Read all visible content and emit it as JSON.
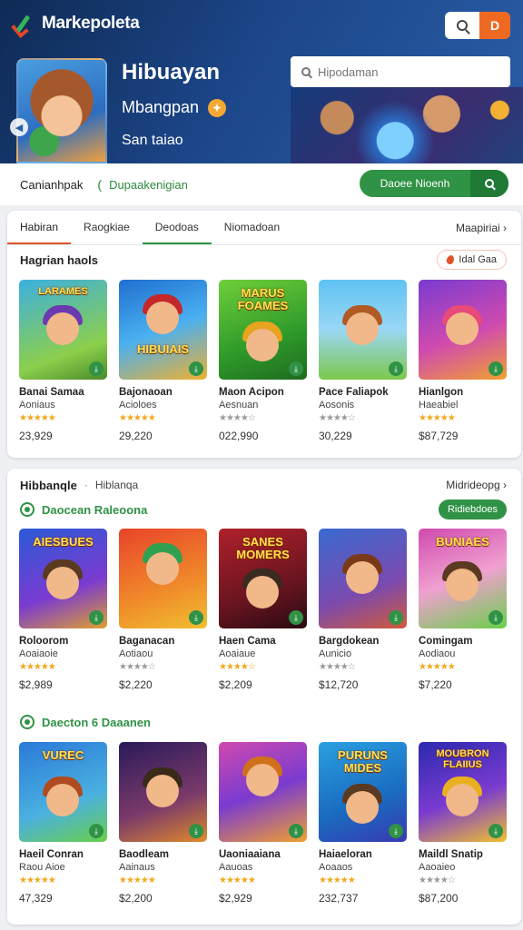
{
  "app": {
    "name": "Markepoleta",
    "user_initial": "D"
  },
  "hero": {
    "title": "Hibuayan",
    "subtitle": "Mbangpan",
    "meta": "San taiao",
    "search_placeholder": "Hipodaman"
  },
  "filter": {
    "label": "Canianhpak",
    "link": "Dupaakenigian",
    "cta": "Daoee Nioenh"
  },
  "tabs": {
    "items": [
      "Habiran",
      "Raogkiae",
      "Deodoas",
      "Niomadoan"
    ],
    "more": "Maapiriai"
  },
  "section1": {
    "title": "Hagrian haols",
    "pill": "Idal Gaa",
    "games": [
      {
        "thumb_title": "LARAMES",
        "name": "Banai Samaa",
        "sub": "Aoniaus",
        "stars": "★★★★★",
        "price": "23,929"
      },
      {
        "thumb_title": "HIBUIAIS",
        "name": "Bajonaoan",
        "sub": "Acioloes",
        "stars": "★★★★★",
        "price": "29,220"
      },
      {
        "thumb_title": "MARUS FOAMES",
        "name": "Maon Acipon",
        "sub": "Aesnuan",
        "stars": "★★★★☆",
        "price": "022,990"
      },
      {
        "thumb_title": "",
        "name": "Pace Faliapok",
        "sub": "Aosonis",
        "stars": "★★★★☆",
        "price": "30,229"
      },
      {
        "thumb_title": "",
        "name": "Hianlgon",
        "sub": "Haeabiel",
        "stars": "★★★★★",
        "price": "$87,729"
      }
    ]
  },
  "category": {
    "title": "Hibbanqle",
    "sub": "Hiblanqa",
    "more": "Midrideopg"
  },
  "section2": {
    "title": "Daocean Raleoona",
    "pill": "Ridiebdoes",
    "games": [
      {
        "thumb_title": "AIESBUES",
        "name": "Roloorom",
        "sub": "Aoaiaoie",
        "stars": "★★★★★",
        "price": "$2,989"
      },
      {
        "thumb_title": "",
        "name": "Baganacan",
        "sub": "Aotiaou",
        "stars": "★★★★☆",
        "price": "$2,220"
      },
      {
        "thumb_title": "SANES MOMERS",
        "name": "Haen Cama",
        "sub": "Aoaiaue",
        "stars": "★★★★☆",
        "price": "$2,209"
      },
      {
        "thumb_title": "",
        "name": "Bargdokean",
        "sub": "Aunicio",
        "stars": "★★★★☆",
        "price": "$12,720"
      },
      {
        "thumb_title": "BUNIAES",
        "name": "Comingam",
        "sub": "Aodiaou",
        "stars": "★★★★★",
        "price": "$7,220"
      }
    ]
  },
  "section3": {
    "title": "Daecton 6 Daaanen",
    "games": [
      {
        "thumb_title": "VUREC",
        "name": "Haeil Conran",
        "sub": "Raou Aioe",
        "stars": "★★★★★",
        "price": "47,329"
      },
      {
        "thumb_title": "",
        "name": "Baodleam",
        "sub": "Aainaus",
        "stars": "★★★★★",
        "price": "$2,200"
      },
      {
        "thumb_title": "",
        "name": "Uaoniaaiana",
        "sub": "Aauoas",
        "stars": "★★★★★",
        "price": "$2,929"
      },
      {
        "thumb_title": "PURUNS MIDES",
        "name": "Haiaeloran",
        "sub": "Aoaaos",
        "stars": "★★★★★",
        "price": "232,737"
      },
      {
        "thumb_title": "MOUBRON FLAIIUS",
        "name": "Maildl Snatip",
        "sub": "Aaoaieo",
        "stars": "★★★★☆",
        "price": "$87,200"
      }
    ]
  },
  "colors": {
    "brand_dark": "#1c4688",
    "accent": "#2f9245",
    "highlight": "#e0532a",
    "user": "#ee6a23"
  },
  "icons": [
    "search-icon",
    "user-icon",
    "play-icon",
    "badge-icon",
    "flame-icon",
    "download-icon",
    "chevron-right-icon"
  ]
}
